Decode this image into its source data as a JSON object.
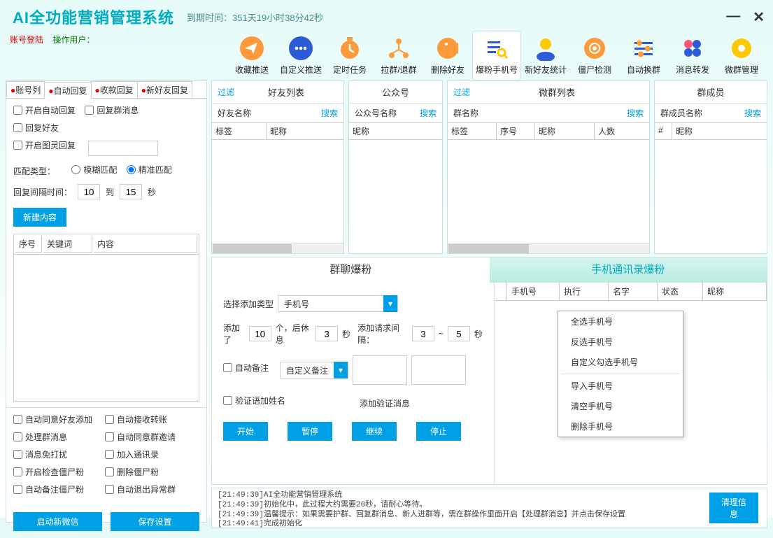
{
  "app": {
    "title": "AI全功能营销管理系统",
    "expiry": "到期时间：351天19小时38分42秒"
  },
  "login": {
    "account_label": "账号登陆",
    "operator_label": "操作用户："
  },
  "mainTabs": {
    "t0": "收藏推送",
    "t1": "自定义推送",
    "t2": "定时任务",
    "t3": "拉群/退群",
    "t4": "删除好友",
    "t5": "爆粉手机号",
    "t6": "新好友统计",
    "t7": "僵尸检测",
    "t8": "自动换群",
    "t9": "消息转发",
    "t10": "微群管理"
  },
  "leftTabs": {
    "t0": "账号列",
    "t1": "自动回复",
    "t2": "收款回复",
    "t3": "新好友回复"
  },
  "leftPanel": {
    "chk_auto_reply": "开启自动回复",
    "chk_reply_group": "回复群消息",
    "chk_reply_friend": "回复好友",
    "chk_tuling": "开启图灵回复",
    "match_label": "匹配类型：",
    "match_fuzzy": "模糊匹配",
    "match_exact": "精准匹配",
    "interval_label": "回复间隔时间：",
    "interval_from": "10",
    "interval_to_label": "到",
    "interval_to": "15",
    "interval_unit": "秒",
    "new_content": "新建内容",
    "th_seq": "序号",
    "th_keyword": "关键词",
    "th_content": "内容",
    "opt0": "自动同意好友添加",
    "opt1": "自动接收转账",
    "opt2": "处理群消息",
    "opt3": "自动同意群邀请",
    "opt4": "消息免打扰",
    "opt5": "加入通讯录",
    "opt6": "开启检查僵尸粉",
    "opt7": "删除僵尸粉",
    "opt8": "自动备注僵尸粉",
    "opt9": "自动退出异常群",
    "btn_new_wechat": "启动新微信",
    "btn_save": "保存设置"
  },
  "lists": {
    "filter": "过滤",
    "search": "搜索",
    "friend_title": "好友列表",
    "friend_name": "好友名称",
    "friend_c0": "标签",
    "friend_c1": "昵称",
    "public_title": "公众号",
    "public_name": "公众号名称",
    "public_c0": "昵称",
    "group_title": "微群列表",
    "group_name": "群名称",
    "group_c0": "标签",
    "group_c1": "序号",
    "group_c2": "昵称",
    "group_c3": "人数",
    "member_title": "群成员",
    "member_name": "群成员名称",
    "member_c0": "#",
    "member_c1": "昵称"
  },
  "lower": {
    "tab0": "群聊爆粉",
    "tab1": "手机通讯录爆粉",
    "add_type_label": "选择添加类型",
    "add_type_value": "手机号",
    "added_label": "添加了",
    "added_val": "10",
    "added_unit": "个，后休息",
    "rest_val": "3",
    "rest_unit": "秒",
    "req_interval_label": "添加请求间隔：",
    "req_from": "3",
    "req_dash": "~",
    "req_to": "5",
    "req_unit": "秒",
    "auto_remark": "自动备注",
    "remark_value": "自定义备注",
    "verify_name": "验证语加姓名",
    "verify_msg_label": "添加验证消息",
    "btn_start": "开始",
    "btn_pause": "暂停",
    "btn_continue": "继续",
    "btn_stop": "停止",
    "ph_c0": "手机号",
    "ph_c1": "执行",
    "ph_c2": "名字",
    "ph_c3": "状态",
    "ph_c4": "昵称",
    "menu0": "全选手机号",
    "menu1": "反选手机号",
    "menu2": "自定义勾选手机号",
    "menu3": "导入手机号",
    "menu4": "清空手机号",
    "menu5": "删除手机号"
  },
  "log": {
    "lines": "[21:49:39]AI全功能营销管理系统\n[21:49:39]初始化中，此过程大约需要20秒，请耐心等待。\n[21:49:39]温馨提示：如果需要护群、回复群消息、新人进群等，需在群操作里面开启【处理群消息】并点击保存设置\n[21:49:41]完成初始化",
    "clear": "清理信息"
  }
}
